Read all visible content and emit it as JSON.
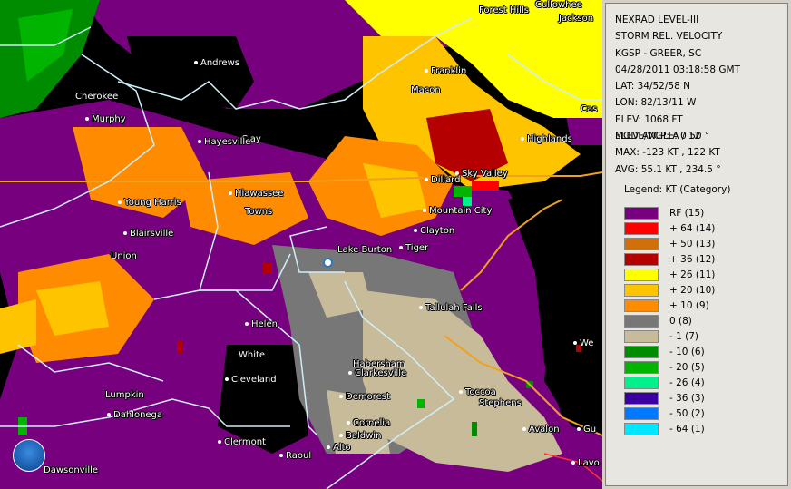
{
  "header": {
    "product": "NEXRAD LEVEL-III",
    "mode": "STORM REL. VELOCITY",
    "station": "KGSP - GREER, SC",
    "datetime": "04/28/2011 03:18:58 GMT",
    "lat": "LAT: 34/52/58 N",
    "lon": "LON: 82/13/11 W",
    "elev": "ELEV: 1068 FT",
    "vcp": "MODE/VCP: A / 12"
  },
  "stats": {
    "elev_angle": "ELEV ANGLE: 0.50 °",
    "max": "MAX: -123 KT , 122 KT",
    "avg": "AVG: 55.1 KT , 234.5 °"
  },
  "legend": {
    "title": "Legend: KT (Category)",
    "items": [
      {
        "label": "RF (15)",
        "color": "#77007f"
      },
      {
        "label": "+ 64  (14)",
        "color": "#ff0000"
      },
      {
        "label": "+ 50  (13)",
        "color": "#d0700a"
      },
      {
        "label": "+ 36  (12)",
        "color": "#b40000"
      },
      {
        "label": "+ 26  (11)",
        "color": "#ffff00"
      },
      {
        "label": "+ 20  (10)",
        "color": "#ffc400"
      },
      {
        "label": "+ 10  (9)",
        "color": "#ff8c00"
      },
      {
        "label": "0  (8)",
        "color": "#777777"
      },
      {
        "label": "- 1  (7)",
        "color": "#c8bb9a"
      },
      {
        "label": "- 10  (6)",
        "color": "#008c00"
      },
      {
        "label": "- 20  (5)",
        "color": "#00b400"
      },
      {
        "label": "- 26  (4)",
        "color": "#00f08c"
      },
      {
        "label": "- 36  (3)",
        "color": "#3c00a0"
      },
      {
        "label": "- 50  (2)",
        "color": "#0078ff"
      },
      {
        "label": "- 64  (1)",
        "color": "#00e6ff"
      }
    ]
  },
  "places": [
    {
      "name": "Forest Hills",
      "dot": false
    },
    {
      "name": "Cullowhee",
      "dot": false
    },
    {
      "name": "Jackson",
      "dot": false
    },
    {
      "name": "Andrews",
      "dot": true
    },
    {
      "name": "Franklin",
      "dot": true
    },
    {
      "name": "Macon",
      "dot": false
    },
    {
      "name": "Cherokee",
      "dot": false
    },
    {
      "name": "Murphy",
      "dot": true
    },
    {
      "name": "Clay",
      "dot": false
    },
    {
      "name": "Hayesville",
      "dot": true
    },
    {
      "name": "Highlands",
      "dot": true
    },
    {
      "name": "Cas",
      "dot": false
    },
    {
      "name": "Sky Valley",
      "dot": true
    },
    {
      "name": "Dillard",
      "dot": true
    },
    {
      "name": "Hiawassee",
      "dot": true
    },
    {
      "name": "Young Harris",
      "dot": true
    },
    {
      "name": "Towns",
      "dot": false
    },
    {
      "name": "Mountain City",
      "dot": true
    },
    {
      "name": "Clayton",
      "dot": true
    },
    {
      "name": "Blairsville",
      "dot": true
    },
    {
      "name": "Lake Burton",
      "dot": false
    },
    {
      "name": "Tiger",
      "dot": true
    },
    {
      "name": "Union",
      "dot": false
    },
    {
      "name": "Tallulah Falls",
      "dot": true
    },
    {
      "name": "Helen",
      "dot": true
    },
    {
      "name": "White",
      "dot": false
    },
    {
      "name": "We",
      "dot": true
    },
    {
      "name": "Habersham",
      "dot": false
    },
    {
      "name": "Clarkesville",
      "dot": true
    },
    {
      "name": "Cleveland",
      "dot": true
    },
    {
      "name": "Lumpkin",
      "dot": false
    },
    {
      "name": "Toccoa",
      "dot": true
    },
    {
      "name": "Stephens",
      "dot": false
    },
    {
      "name": "Demorest",
      "dot": true
    },
    {
      "name": "Dahlonega",
      "dot": true
    },
    {
      "name": "Cornelia",
      "dot": true
    },
    {
      "name": "Avalon",
      "dot": true
    },
    {
      "name": "Gu",
      "dot": true
    },
    {
      "name": "Baldwin",
      "dot": true
    },
    {
      "name": "Clermont",
      "dot": true
    },
    {
      "name": "Alto",
      "dot": true
    },
    {
      "name": "Raoul",
      "dot": true
    },
    {
      "name": "Dawsonville",
      "dot": false
    },
    {
      "name": "Lavo",
      "dot": true
    }
  ],
  "logo_text": "NOAA"
}
